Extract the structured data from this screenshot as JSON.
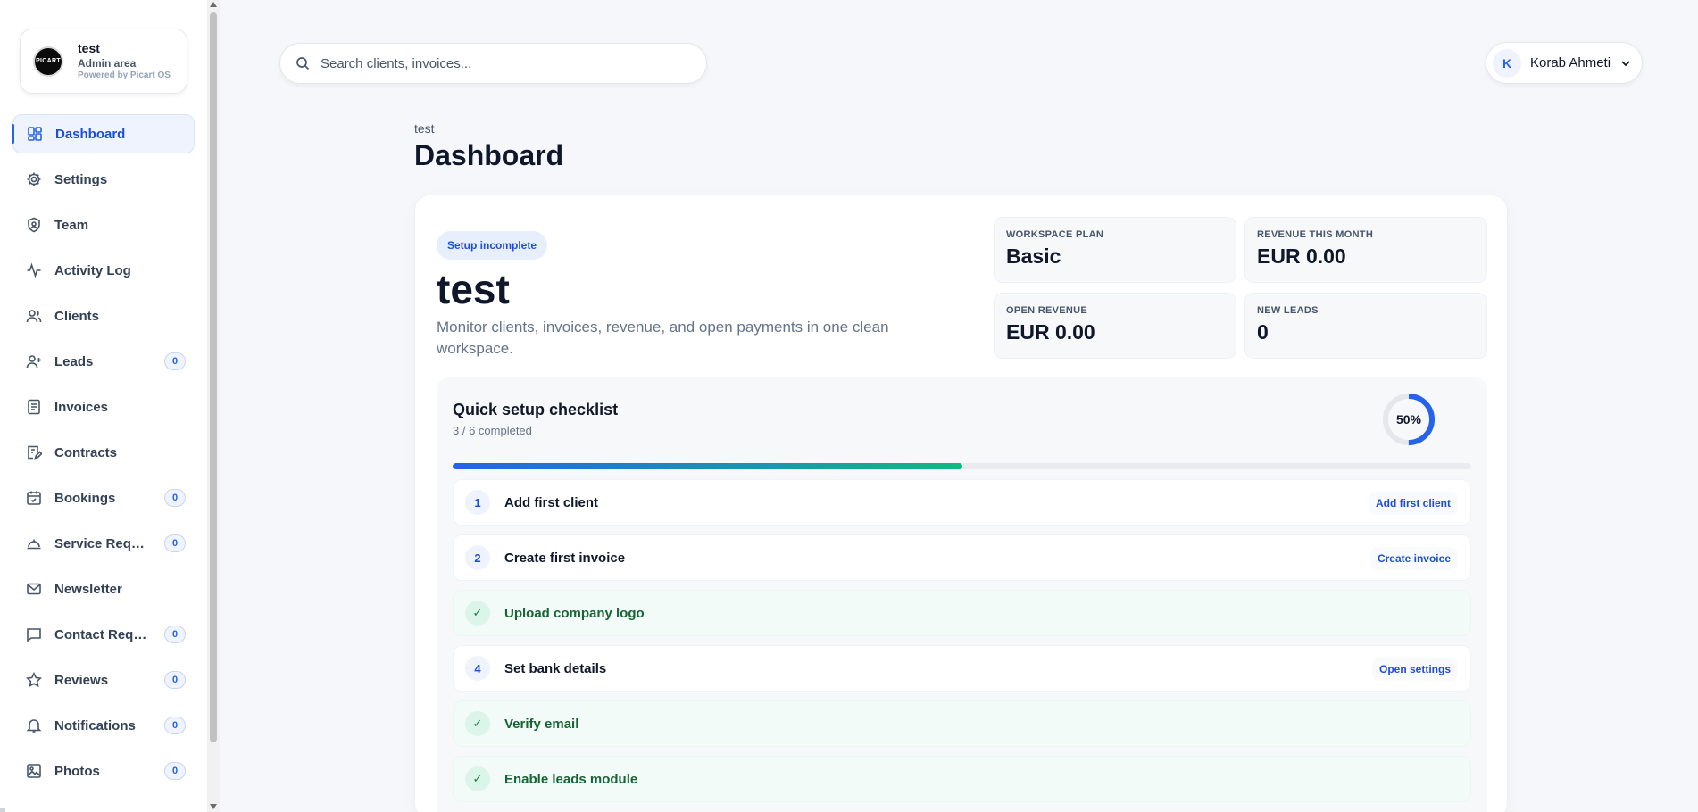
{
  "brand": {
    "logo_text": "PICART",
    "name": "test",
    "subtitle": "Admin area",
    "powered": "Powered by Picart OS"
  },
  "sidebar": {
    "items": [
      {
        "label": "Dashboard",
        "icon": "dashboard-icon",
        "active": true
      },
      {
        "label": "Settings",
        "icon": "gear-icon"
      },
      {
        "label": "Team",
        "icon": "shield-icon"
      },
      {
        "label": "Activity Log",
        "icon": "activity-icon"
      },
      {
        "label": "Clients",
        "icon": "users-icon"
      },
      {
        "label": "Leads",
        "icon": "user-plus-icon",
        "badge": "0"
      },
      {
        "label": "Invoices",
        "icon": "invoice-icon"
      },
      {
        "label": "Contracts",
        "icon": "contract-icon"
      },
      {
        "label": "Bookings",
        "icon": "calendar-icon",
        "badge": "0"
      },
      {
        "label": "Service Requ...",
        "icon": "bell-service-icon",
        "badge": "0"
      },
      {
        "label": "Newsletter",
        "icon": "mail-icon"
      },
      {
        "label": "Contact Requ...",
        "icon": "message-icon",
        "badge": "0"
      },
      {
        "label": "Reviews",
        "icon": "star-icon",
        "badge": "0"
      },
      {
        "label": "Notifications",
        "icon": "bell-icon",
        "badge": "0"
      },
      {
        "label": "Photos",
        "icon": "image-icon",
        "badge": "0"
      }
    ]
  },
  "search": {
    "placeholder": "Search clients, invoices..."
  },
  "user": {
    "initial": "K",
    "name": "Korab Ahmeti"
  },
  "page": {
    "breadcrumb": "test",
    "title": "Dashboard"
  },
  "hero": {
    "badge": "Setup incomplete",
    "title": "test",
    "description": "Monitor clients, invoices, revenue, and open payments in one clean workspace."
  },
  "stats": [
    {
      "label": "WORKSPACE PLAN",
      "value": "Basic"
    },
    {
      "label": "REVENUE THIS MONTH",
      "value": "EUR 0.00"
    },
    {
      "label": "OPEN REVENUE",
      "value": "EUR 0.00"
    },
    {
      "label": "NEW LEADS",
      "value": "0"
    }
  ],
  "checklist": {
    "title": "Quick setup checklist",
    "completed_text": "3 / 6 completed",
    "percent_label": "50%",
    "progress": 0.5,
    "colors": {
      "accent": "#2563eb",
      "success": "#10b981"
    },
    "items": [
      {
        "marker": "1",
        "label": "Add first client",
        "action": "Add first client",
        "done": false
      },
      {
        "marker": "2",
        "label": "Create first invoice",
        "action": "Create invoice",
        "done": false
      },
      {
        "marker": "✓",
        "label": "Upload company logo",
        "done": true
      },
      {
        "marker": "4",
        "label": "Set bank details",
        "action": "Open settings",
        "done": false
      },
      {
        "marker": "✓",
        "label": "Verify email",
        "done": true
      },
      {
        "marker": "✓",
        "label": "Enable leads module",
        "done": true
      }
    ]
  }
}
